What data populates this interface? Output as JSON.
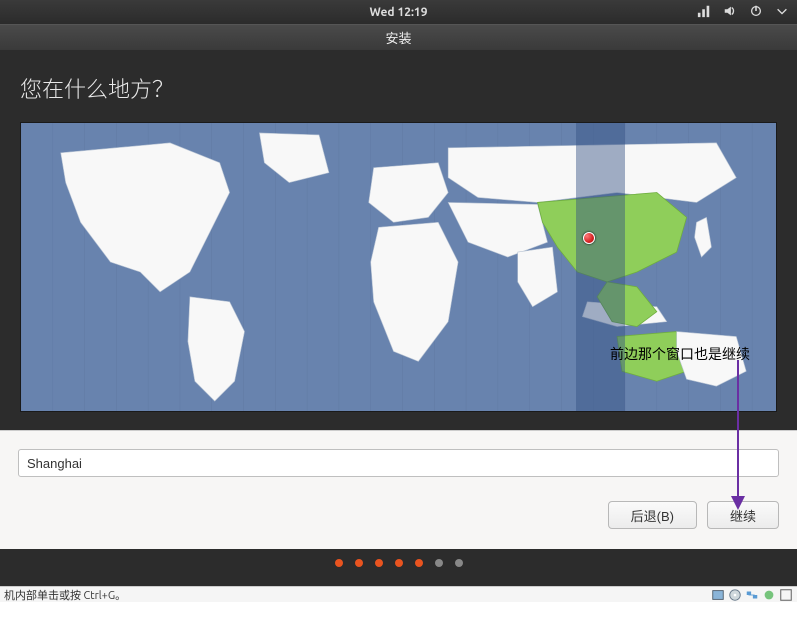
{
  "topbar": {
    "time": "Wed 12:19"
  },
  "titlebar": {
    "title": "安装"
  },
  "heading": "您在什么地方？",
  "location": {
    "value": "Shanghai"
  },
  "buttons": {
    "back": "后退(B)",
    "continue": "继续"
  },
  "annotation": "前边那个窗口也是继续",
  "footer": {
    "hint": "机内部单击或按 Ctrl+G。"
  },
  "pager": {
    "total": 7,
    "active": 5
  },
  "colors": {
    "accent": "#e95420",
    "map_sea": "#6883ae",
    "map_land": "#f8f8f8",
    "map_highlight": "#8fce5a"
  }
}
